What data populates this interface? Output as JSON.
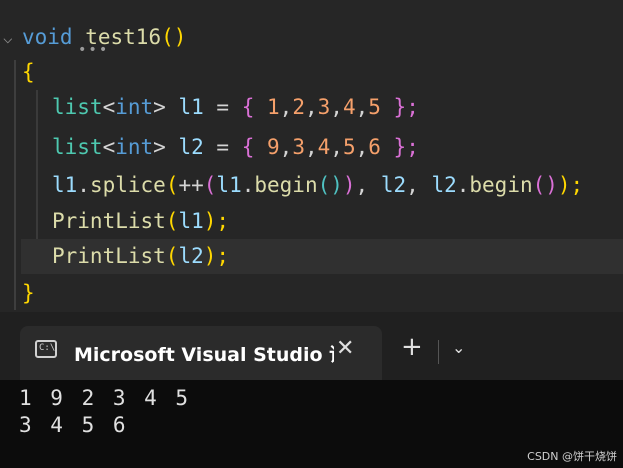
{
  "editor": {
    "lines": [
      {
        "tokens": [
          {
            "t": "void",
            "c": "kw"
          },
          {
            "t": " ",
            "c": "punc"
          },
          {
            "t": "test16",
            "c": "fn"
          },
          {
            "t": "()",
            "c": "paren"
          }
        ]
      },
      {
        "tokens": [
          {
            "t": "{",
            "c": "paren"
          }
        ]
      },
      {
        "tokens": [
          {
            "t": "list",
            "c": "type"
          },
          {
            "t": "<",
            "c": "punc"
          },
          {
            "t": "int",
            "c": "kw"
          },
          {
            "t": "> ",
            "c": "punc"
          },
          {
            "t": "l1",
            "c": "var"
          },
          {
            "t": " = ",
            "c": "punc"
          },
          {
            "t": "{ ",
            "c": "paren2"
          },
          {
            "t": "1",
            "c": "num"
          },
          {
            "t": ",",
            "c": "punc"
          },
          {
            "t": "2",
            "c": "num"
          },
          {
            "t": ",",
            "c": "punc"
          },
          {
            "t": "3",
            "c": "num"
          },
          {
            "t": ",",
            "c": "punc"
          },
          {
            "t": "4",
            "c": "num"
          },
          {
            "t": ",",
            "c": "punc"
          },
          {
            "t": "5",
            "c": "num"
          },
          {
            "t": " };",
            "c": "paren2"
          }
        ]
      },
      {
        "tokens": [
          {
            "t": "list",
            "c": "type"
          },
          {
            "t": "<",
            "c": "punc"
          },
          {
            "t": "int",
            "c": "kw"
          },
          {
            "t": "> ",
            "c": "punc"
          },
          {
            "t": "l2",
            "c": "var"
          },
          {
            "t": " = ",
            "c": "punc"
          },
          {
            "t": "{ ",
            "c": "paren2"
          },
          {
            "t": "9",
            "c": "num"
          },
          {
            "t": ",",
            "c": "punc"
          },
          {
            "t": "3",
            "c": "num"
          },
          {
            "t": ",",
            "c": "punc"
          },
          {
            "t": "4",
            "c": "num"
          },
          {
            "t": ",",
            "c": "punc"
          },
          {
            "t": "5",
            "c": "num"
          },
          {
            "t": ",",
            "c": "punc"
          },
          {
            "t": "6",
            "c": "num"
          },
          {
            "t": " };",
            "c": "paren2"
          }
        ]
      },
      {
        "tokens": [
          {
            "t": "l1",
            "c": "var"
          },
          {
            "t": ".",
            "c": "punc"
          },
          {
            "t": "splice",
            "c": "fn"
          },
          {
            "t": "(",
            "c": "paren"
          },
          {
            "t": "++",
            "c": "punc"
          },
          {
            "t": "(",
            "c": "paren2"
          },
          {
            "t": "l1",
            "c": "var"
          },
          {
            "t": ".",
            "c": "punc"
          },
          {
            "t": "begin",
            "c": "fn"
          },
          {
            "t": "()",
            "c": "brace"
          },
          {
            "t": ")",
            "c": "paren2"
          },
          {
            "t": ", ",
            "c": "punc"
          },
          {
            "t": "l2",
            "c": "var"
          },
          {
            "t": ", ",
            "c": "punc"
          },
          {
            "t": "l2",
            "c": "var"
          },
          {
            "t": ".",
            "c": "punc"
          },
          {
            "t": "begin",
            "c": "fn"
          },
          {
            "t": "()",
            "c": "paren2"
          },
          {
            "t": ");",
            "c": "paren"
          }
        ]
      },
      {
        "tokens": [
          {
            "t": "PrintList",
            "c": "fn"
          },
          {
            "t": "(",
            "c": "paren"
          },
          {
            "t": "l1",
            "c": "var"
          },
          {
            "t": ");",
            "c": "paren"
          }
        ]
      },
      {
        "tokens": [
          {
            "t": "PrintList",
            "c": "fn"
          },
          {
            "t": "(",
            "c": "paren"
          },
          {
            "t": "l2",
            "c": "var"
          },
          {
            "t": ");",
            "c": "paren"
          }
        ]
      },
      {
        "tokens": [
          {
            "t": "}",
            "c": "paren"
          }
        ]
      }
    ]
  },
  "terminal": {
    "tab_title": "Microsoft Visual Studio 调试控制台",
    "tab_icon_text": "C:\\",
    "close_glyph": "✕",
    "new_tab_glyph": "+",
    "dropdown_glyph": "⌄",
    "output": [
      "1 9 2 3 4 5",
      "3 4 5 6"
    ]
  },
  "watermark": "CSDN @饼干烧饼"
}
